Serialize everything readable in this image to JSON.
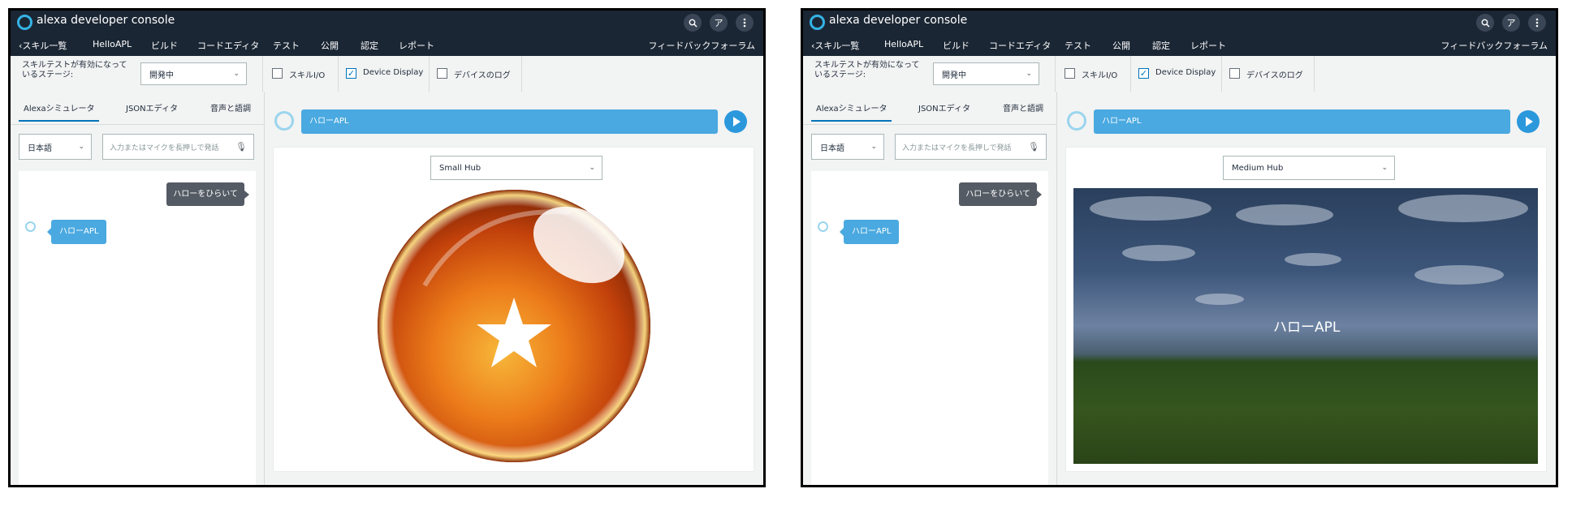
{
  "header": {
    "app_title": "alexa developer console",
    "search_icon": "search-icon",
    "account_initial": "ア",
    "menu_icon": "more-icon"
  },
  "nav": {
    "back": "スキル一覧",
    "skill_name": "HelloAPL",
    "build": "ビルド",
    "code_editor": "コードエディタ",
    "test": "テスト",
    "publish": "公開",
    "certification": "認定",
    "report": "レポート",
    "feedback": "フィードバックフォーラム"
  },
  "toolbar": {
    "stage_label": "スキルテストが有効になっているステージ:",
    "stage_value": "開発中",
    "skill_io": "スキルI/O",
    "device_display": "Device Display",
    "device_log": "デバイスのログ",
    "skill_io_checked": false,
    "device_display_checked": true,
    "device_log_checked": false
  },
  "simulator": {
    "tabs": [
      "Alexaシミュレータ",
      "JSONエディタ",
      "音声と語調"
    ],
    "language": "日本語",
    "input_placeholder": "入力またはマイクを長押しで発話",
    "user_message": "ハローをひらいて",
    "alexa_response": "ハローAPL"
  },
  "display": {
    "utterance": "ハローAPL",
    "left_device": "Small Hub",
    "right_device": "Medium Hub",
    "right_screen_text": "ハローAPL"
  },
  "colors": {
    "header_bg": "#1b2634",
    "accent_blue": "#4aa9e0",
    "alexa_ring": "#34b3e4"
  }
}
